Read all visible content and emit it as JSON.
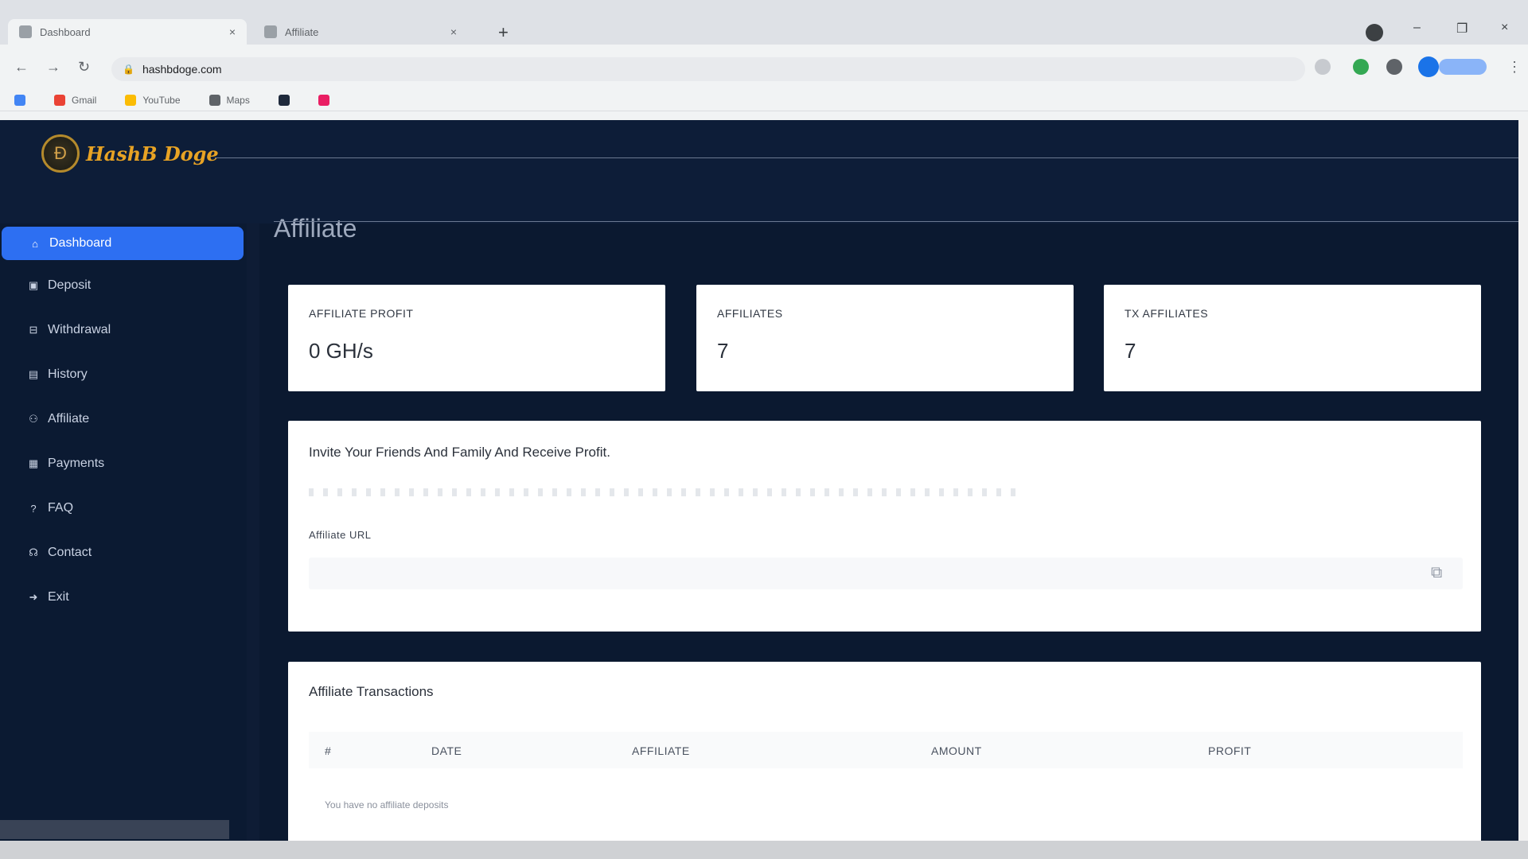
{
  "browser": {
    "active_tab_title": "Dashboard",
    "inactive_tab_title": "Affiliate",
    "url": "hashbdoge.com",
    "bookmarks": [
      "Gmail",
      "YouTube",
      "Maps"
    ],
    "window_controls": {
      "minimize": "–",
      "maximize": "❐",
      "close": "×"
    }
  },
  "brand": {
    "name": "HashB Doge",
    "accent": "#e8a324"
  },
  "sidebar": {
    "items": [
      {
        "label": "Dashboard",
        "icon": "dashboard-icon"
      },
      {
        "label": "Deposit",
        "icon": "deposit-icon"
      },
      {
        "label": "Withdrawal",
        "icon": "withdrawal-icon"
      },
      {
        "label": "History",
        "icon": "history-icon"
      },
      {
        "label": "Affiliate",
        "icon": "affiliate-icon"
      },
      {
        "label": "Payments",
        "icon": "payments-icon"
      },
      {
        "label": "FAQ",
        "icon": "faq-icon"
      },
      {
        "label": "Contact",
        "icon": "contact-icon"
      },
      {
        "label": "Exit",
        "icon": "exit-icon"
      }
    ],
    "active_color": "#2d6ff2"
  },
  "main": {
    "title": "Affiliate",
    "stats": [
      {
        "label": "AFFILIATE PROFIT",
        "value": "0 GH/s"
      },
      {
        "label": "AFFILIATES",
        "value": "7"
      },
      {
        "label": "TX AFFILIATES",
        "value": "7"
      }
    ],
    "invite": {
      "title": "Invite Your Friends And Family And Receive Profit.",
      "affiliate_url_label": "Affiliate URL"
    },
    "transactions": {
      "title": "Affiliate Transactions",
      "columns": [
        "#",
        "DATE",
        "AFFILIATE",
        "AMOUNT",
        "PROFIT"
      ],
      "empty_message": "You have no affiliate deposits"
    }
  }
}
